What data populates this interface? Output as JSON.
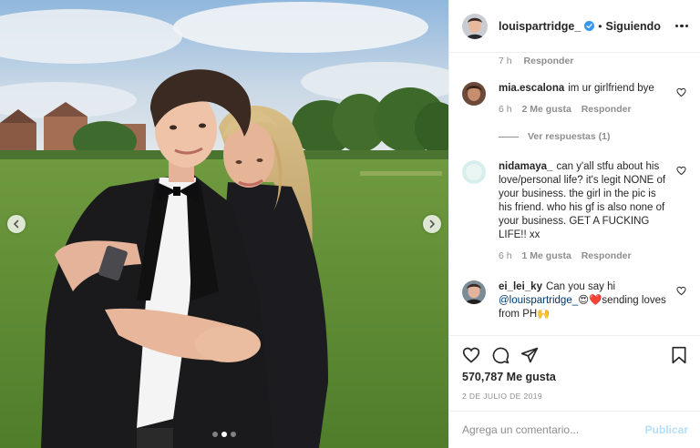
{
  "header": {
    "username": "louispartridge_",
    "separator": "•",
    "follow_label": "Siguiendo",
    "verified_icon": "verified-badge-icon",
    "more_icon": "more-options-icon"
  },
  "top_meta": {
    "time": "7 h",
    "reply": "Responder"
  },
  "comments": [
    {
      "user": "mia.escalona",
      "text": "im ur girlfriend bye",
      "time": "6 h",
      "likes": "2 Me gusta",
      "reply": "Responder"
    },
    {
      "replies_label": "Ver respuestas (1)"
    },
    {
      "user": "nidamaya_",
      "text": "can y'all stfu about his love/personal life? it's legit NONE of your business. the girl in the pic is his friend. who his gf is also none of your business. GET A FUCKING LIFE!! xx",
      "time": "6 h",
      "likes": "1 Me gusta",
      "reply": "Responder"
    },
    {
      "user": "ei_lei_ky",
      "text_before": "Can you say hi",
      "mention": "@louispartridge_",
      "text_after": "😍❤️sending loves from PH🙌"
    }
  ],
  "actions": {
    "likes": "570,787 Me gusta",
    "date": "2 DE JULIO DE 2019",
    "icons": [
      "heart-icon",
      "comment-icon",
      "share-icon",
      "save-icon"
    ]
  },
  "add_comment": {
    "placeholder": "Agrega un comentario...",
    "publish_label": "Publicar"
  },
  "carousel": {
    "slides": 3,
    "active": 2
  },
  "colors": {
    "accent_blue": "#3897f0",
    "publish_disabled": "#b2dffc",
    "text": "#262626",
    "muted": "#8e8e8e",
    "border": "#efefef"
  }
}
